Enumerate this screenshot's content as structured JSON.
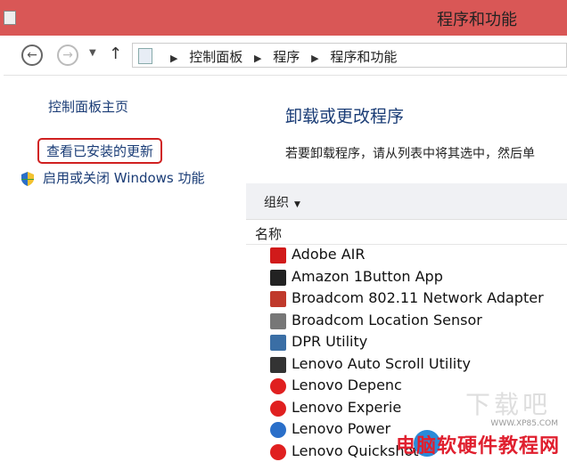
{
  "window": {
    "title": "程序和功能",
    "accent": "#d95756"
  },
  "nav": {
    "back_icon": "back-arrow-icon",
    "forward_icon": "forward-arrow-icon",
    "up_icon": "up-arrow-icon"
  },
  "breadcrumb": {
    "items": [
      "控制面板",
      "程序",
      "程序和功能"
    ]
  },
  "sidebar": {
    "home_label": "控制面板主页",
    "updates_label": "查看已安装的更新",
    "features_label": "启用或关闭 Windows 功能"
  },
  "main": {
    "title": "卸载或更改程序",
    "description": "若要卸载程序，请从列表中将其选中，然后单"
  },
  "toolbar": {
    "organize_label": "组织"
  },
  "list": {
    "column_name": "名称",
    "programs": [
      {
        "name": "Adobe AIR",
        "icon": "adobe-air-icon",
        "color": "#d11a1a"
      },
      {
        "name": "Amazon 1Button App",
        "icon": "amazon-icon",
        "color": "#222222"
      },
      {
        "name": "Broadcom 802.11 Network Adapter",
        "icon": "network-adapter-icon",
        "color": "#c0392b"
      },
      {
        "name": "Broadcom Location Sensor",
        "icon": "location-sensor-icon",
        "color": "#777777"
      },
      {
        "name": "DPR Utility",
        "icon": "dpr-utility-icon",
        "color": "#3a6ea5"
      },
      {
        "name": "Lenovo Auto Scroll Utility",
        "icon": "auto-scroll-icon",
        "color": "#333333"
      },
      {
        "name": "Lenovo Depenc",
        "icon": "lenovo-red-icon",
        "color": "#e02020"
      },
      {
        "name": "Lenovo Experie",
        "icon": "lenovo-red-icon",
        "color": "#e02020"
      },
      {
        "name": "Lenovo Power",
        "icon": "lenovo-power-icon",
        "color": "#2a6fc9"
      },
      {
        "name": "Lenovo Quickshot",
        "icon": "lenovo-red-icon",
        "color": "#e02020"
      }
    ]
  },
  "watermark": {
    "text": "电脑软硬件教程网",
    "url": "WWW.XP85.COM",
    "logo": "watermark-logo-icon"
  }
}
